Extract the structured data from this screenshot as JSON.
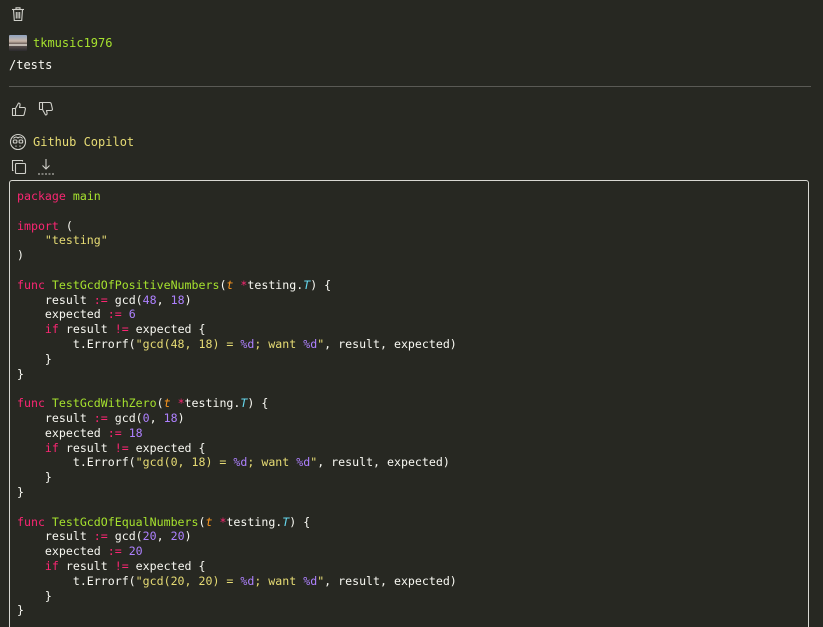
{
  "conversation": {
    "user": {
      "name": "tkmusic1976",
      "message": "/tests"
    },
    "assistant": {
      "name": "Github Copilot"
    },
    "code": {
      "lines": [
        [
          {
            "t": "package",
            "c": "kw"
          },
          {
            "t": " ",
            "c": "plain"
          },
          {
            "t": "main",
            "c": "pk"
          }
        ],
        [],
        [
          {
            "t": "import",
            "c": "kw"
          },
          {
            "t": " (",
            "c": "plain"
          }
        ],
        [
          {
            "t": "    ",
            "c": "plain"
          },
          {
            "t": "\"testing\"",
            "c": "str"
          }
        ],
        [
          {
            "t": ")",
            "c": "plain"
          }
        ],
        [],
        [
          {
            "t": "func",
            "c": "kw"
          },
          {
            "t": " ",
            "c": "plain"
          },
          {
            "t": "TestGcdOfPositiveNumbers",
            "c": "fn"
          },
          {
            "t": "(",
            "c": "plain"
          },
          {
            "t": "t",
            "c": "param"
          },
          {
            "t": " ",
            "c": "plain"
          },
          {
            "t": "*",
            "c": "op"
          },
          {
            "t": "testing.",
            "c": "plain"
          },
          {
            "t": "T",
            "c": "typ"
          },
          {
            "t": ") {",
            "c": "plain"
          }
        ],
        [
          {
            "t": "    result ",
            "c": "plain"
          },
          {
            "t": ":=",
            "c": "op"
          },
          {
            "t": " gcd(",
            "c": "plain"
          },
          {
            "t": "48",
            "c": "num"
          },
          {
            "t": ", ",
            "c": "plain"
          },
          {
            "t": "18",
            "c": "num"
          },
          {
            "t": ")",
            "c": "plain"
          }
        ],
        [
          {
            "t": "    expected ",
            "c": "plain"
          },
          {
            "t": ":=",
            "c": "op"
          },
          {
            "t": " ",
            "c": "plain"
          },
          {
            "t": "6",
            "c": "num"
          }
        ],
        [
          {
            "t": "    ",
            "c": "plain"
          },
          {
            "t": "if",
            "c": "kw"
          },
          {
            "t": " result ",
            "c": "plain"
          },
          {
            "t": "!=",
            "c": "op"
          },
          {
            "t": " expected {",
            "c": "plain"
          }
        ],
        [
          {
            "t": "        t.Errorf(",
            "c": "plain"
          },
          {
            "t": "\"gcd(48, 18) = ",
            "c": "str"
          },
          {
            "t": "%d",
            "c": "num"
          },
          {
            "t": "; want ",
            "c": "str"
          },
          {
            "t": "%d",
            "c": "num"
          },
          {
            "t": "\"",
            "c": "str"
          },
          {
            "t": ", result, expected)",
            "c": "plain"
          }
        ],
        [
          {
            "t": "    }",
            "c": "plain"
          }
        ],
        [
          {
            "t": "}",
            "c": "plain"
          }
        ],
        [],
        [
          {
            "t": "func",
            "c": "kw"
          },
          {
            "t": " ",
            "c": "plain"
          },
          {
            "t": "TestGcdWithZero",
            "c": "fn"
          },
          {
            "t": "(",
            "c": "plain"
          },
          {
            "t": "t",
            "c": "param"
          },
          {
            "t": " ",
            "c": "plain"
          },
          {
            "t": "*",
            "c": "op"
          },
          {
            "t": "testing.",
            "c": "plain"
          },
          {
            "t": "T",
            "c": "typ"
          },
          {
            "t": ") {",
            "c": "plain"
          }
        ],
        [
          {
            "t": "    result ",
            "c": "plain"
          },
          {
            "t": ":=",
            "c": "op"
          },
          {
            "t": " gcd(",
            "c": "plain"
          },
          {
            "t": "0",
            "c": "num"
          },
          {
            "t": ", ",
            "c": "plain"
          },
          {
            "t": "18",
            "c": "num"
          },
          {
            "t": ")",
            "c": "plain"
          }
        ],
        [
          {
            "t": "    expected ",
            "c": "plain"
          },
          {
            "t": ":=",
            "c": "op"
          },
          {
            "t": " ",
            "c": "plain"
          },
          {
            "t": "18",
            "c": "num"
          }
        ],
        [
          {
            "t": "    ",
            "c": "plain"
          },
          {
            "t": "if",
            "c": "kw"
          },
          {
            "t": " result ",
            "c": "plain"
          },
          {
            "t": "!=",
            "c": "op"
          },
          {
            "t": " expected {",
            "c": "plain"
          }
        ],
        [
          {
            "t": "        t.Errorf(",
            "c": "plain"
          },
          {
            "t": "\"gcd(0, 18) = ",
            "c": "str"
          },
          {
            "t": "%d",
            "c": "num"
          },
          {
            "t": "; want ",
            "c": "str"
          },
          {
            "t": "%d",
            "c": "num"
          },
          {
            "t": "\"",
            "c": "str"
          },
          {
            "t": ", result, expected)",
            "c": "plain"
          }
        ],
        [
          {
            "t": "    }",
            "c": "plain"
          }
        ],
        [
          {
            "t": "}",
            "c": "plain"
          }
        ],
        [],
        [
          {
            "t": "func",
            "c": "kw"
          },
          {
            "t": " ",
            "c": "plain"
          },
          {
            "t": "TestGcdOfEqualNumbers",
            "c": "fn"
          },
          {
            "t": "(",
            "c": "plain"
          },
          {
            "t": "t",
            "c": "param"
          },
          {
            "t": " ",
            "c": "plain"
          },
          {
            "t": "*",
            "c": "op"
          },
          {
            "t": "testing.",
            "c": "plain"
          },
          {
            "t": "T",
            "c": "typ"
          },
          {
            "t": ") {",
            "c": "plain"
          }
        ],
        [
          {
            "t": "    result ",
            "c": "plain"
          },
          {
            "t": ":=",
            "c": "op"
          },
          {
            "t": " gcd(",
            "c": "plain"
          },
          {
            "t": "20",
            "c": "num"
          },
          {
            "t": ", ",
            "c": "plain"
          },
          {
            "t": "20",
            "c": "num"
          },
          {
            "t": ")",
            "c": "plain"
          }
        ],
        [
          {
            "t": "    expected ",
            "c": "plain"
          },
          {
            "t": ":=",
            "c": "op"
          },
          {
            "t": " ",
            "c": "plain"
          },
          {
            "t": "20",
            "c": "num"
          }
        ],
        [
          {
            "t": "    ",
            "c": "plain"
          },
          {
            "t": "if",
            "c": "kw"
          },
          {
            "t": " result ",
            "c": "plain"
          },
          {
            "t": "!=",
            "c": "op"
          },
          {
            "t": " expected {",
            "c": "plain"
          }
        ],
        [
          {
            "t": "        t.Errorf(",
            "c": "plain"
          },
          {
            "t": "\"gcd(20, 20) = ",
            "c": "str"
          },
          {
            "t": "%d",
            "c": "num"
          },
          {
            "t": "; want ",
            "c": "str"
          },
          {
            "t": "%d",
            "c": "num"
          },
          {
            "t": "\"",
            "c": "str"
          },
          {
            "t": ", result, expected)",
            "c": "plain"
          }
        ],
        [
          {
            "t": "    }",
            "c": "plain"
          }
        ],
        [
          {
            "t": "}",
            "c": "plain"
          }
        ]
      ]
    }
  },
  "icons": {
    "delete": "trash-icon",
    "like": "thumbs-up-icon",
    "dislike": "thumbs-down-icon",
    "assistant_avatar": "copilot-icon",
    "copy": "copy-icon",
    "insert": "insert-at-cursor-icon"
  },
  "theme": {
    "background": "#272822",
    "username_color": "#a6e22e",
    "assistant_name_color": "#e6db74",
    "keyword": "#f92672",
    "string": "#e6db74",
    "number": "#ae81ff",
    "type": "#66d9ef",
    "param": "#fd971f"
  }
}
